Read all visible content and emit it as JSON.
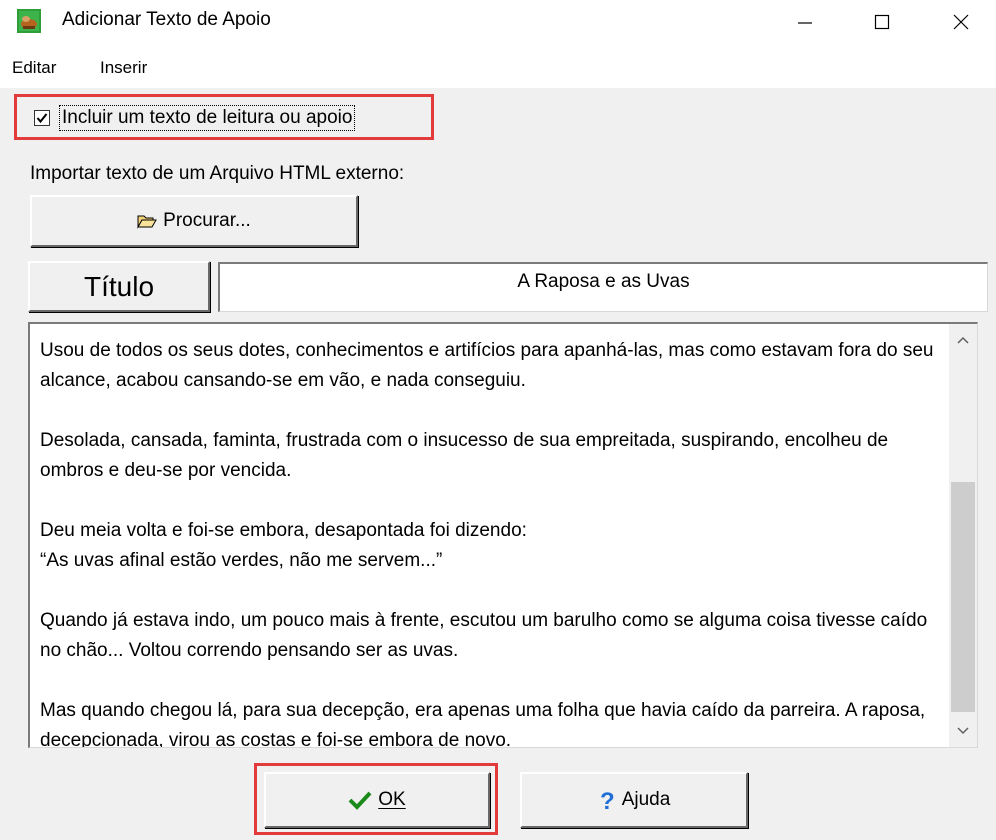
{
  "window": {
    "title": "Adicionar Texto de Apoio",
    "icon": "app-icon"
  },
  "menu": {
    "items": [
      {
        "label": "Editar"
      },
      {
        "label": "Inserir"
      }
    ]
  },
  "include_text": {
    "checked": true,
    "label": "Incluir um texto de leitura ou apoio"
  },
  "import": {
    "label": "Importar texto de um Arquivo HTML externo:",
    "browse_button": "Procurar...",
    "browse_icon": "folder-open-icon"
  },
  "title_field": {
    "button_label": "Título",
    "value": "A Raposa e as Uvas"
  },
  "text_body": {
    "paragraphs": [
      "Usou de todos os seus dotes, conhecimentos e artifícios para apanhá-las, mas como estavam fora do seu alcance, acabou cansando-se em vão, e nada conseguiu.",
      "Desolada, cansada, faminta, frustrada com o insucesso de sua empreitada, suspirando, encolheu de ombros e deu-se por vencida.",
      "Deu meia volta e foi-se embora, desapontada foi dizendo:\n“As uvas afinal estão verdes, não me servem...”",
      "Quando já estava indo, um pouco mais à frente, escutou um barulho como se alguma coisa tivesse caído no chão... Voltou correndo pensando ser as uvas.",
      "Mas quando chegou lá, para sua decepção, era apenas uma folha que havia caído da parreira. A raposa, decepcionada, virou as costas e foi-se embora de novo."
    ]
  },
  "buttons": {
    "ok_label": "OK",
    "ok_icon": "checkmark-icon",
    "help_label": "Ajuda",
    "help_icon": "question-icon"
  },
  "colors": {
    "highlight": "#e23b3b",
    "check_green": "#1a8a1a",
    "help_blue": "#1f6fd6"
  }
}
